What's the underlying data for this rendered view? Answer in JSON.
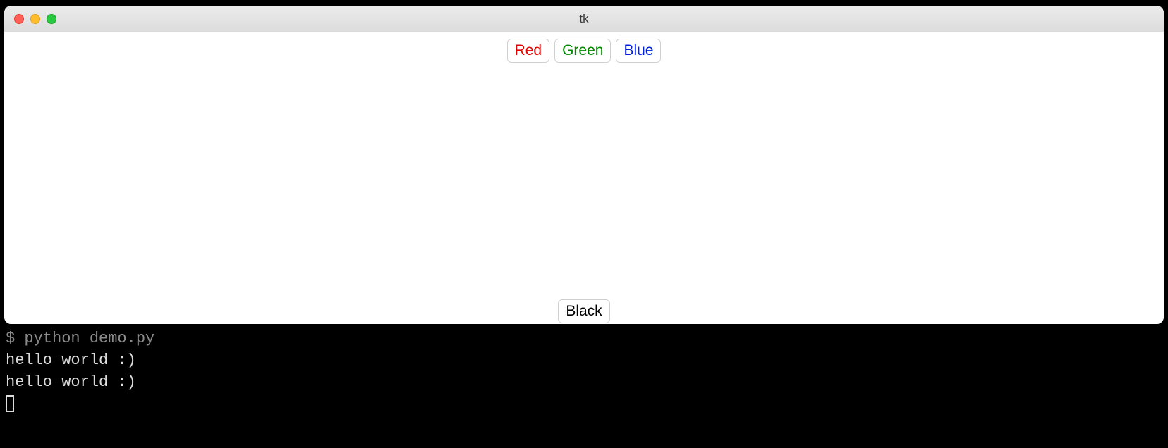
{
  "window": {
    "title": "tk",
    "buttons": {
      "red": "Red",
      "green": "Green",
      "blue": "Blue",
      "black": "Black"
    },
    "colors": {
      "red": "#e60000",
      "green": "#008800",
      "blue": "#0020dd",
      "black": "#000000"
    }
  },
  "terminal": {
    "prompt_symbol": "$ ",
    "command": "python demo.py",
    "output": [
      "hello world :)",
      "hello world :)"
    ]
  }
}
